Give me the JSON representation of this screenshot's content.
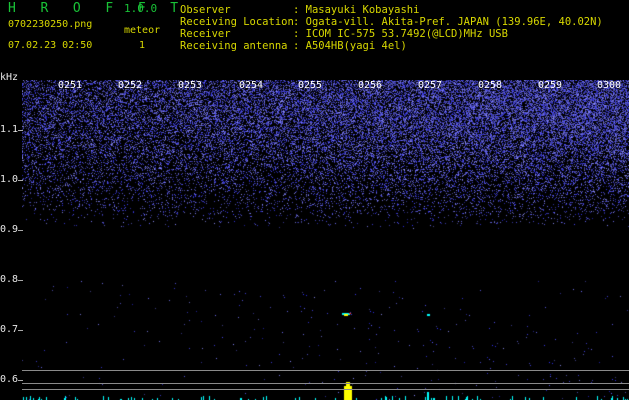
{
  "header": {
    "app_title": "H R O F F T",
    "app_version": "1.0.0",
    "file_name": "0702230250.png",
    "meteor_label": "meteor",
    "timestamp": "07.02.23 02:50",
    "meteor_count": "1"
  },
  "info": [
    {
      "key": "Observer",
      "value": ": Masayuki Kobayashi"
    },
    {
      "key": "Receiving Location",
      "value": ": Ogata-vill. Akita-Pref. JAPAN (139.96E, 40.02N)"
    },
    {
      "key": "Receiver",
      "value": ": ICOM IC-575 53.7492(@LCD)MHz USB"
    },
    {
      "key": "Receiving antenna",
      "value": ": A504HB(yagi 4el)"
    }
  ],
  "spectrogram": {
    "unit": "kHz",
    "time_labels": [
      "0251",
      "0252",
      "0253",
      "0254",
      "0255",
      "0256",
      "0257",
      "0258",
      "0259",
      "0300"
    ],
    "freq_labels": [
      "1.1",
      "1.0",
      "0.9",
      "0.8",
      "0.7",
      "0.6"
    ],
    "colors": {
      "noise": "#3a3aff",
      "echo": "#ffff00",
      "trace": "#00ffff"
    }
  }
}
